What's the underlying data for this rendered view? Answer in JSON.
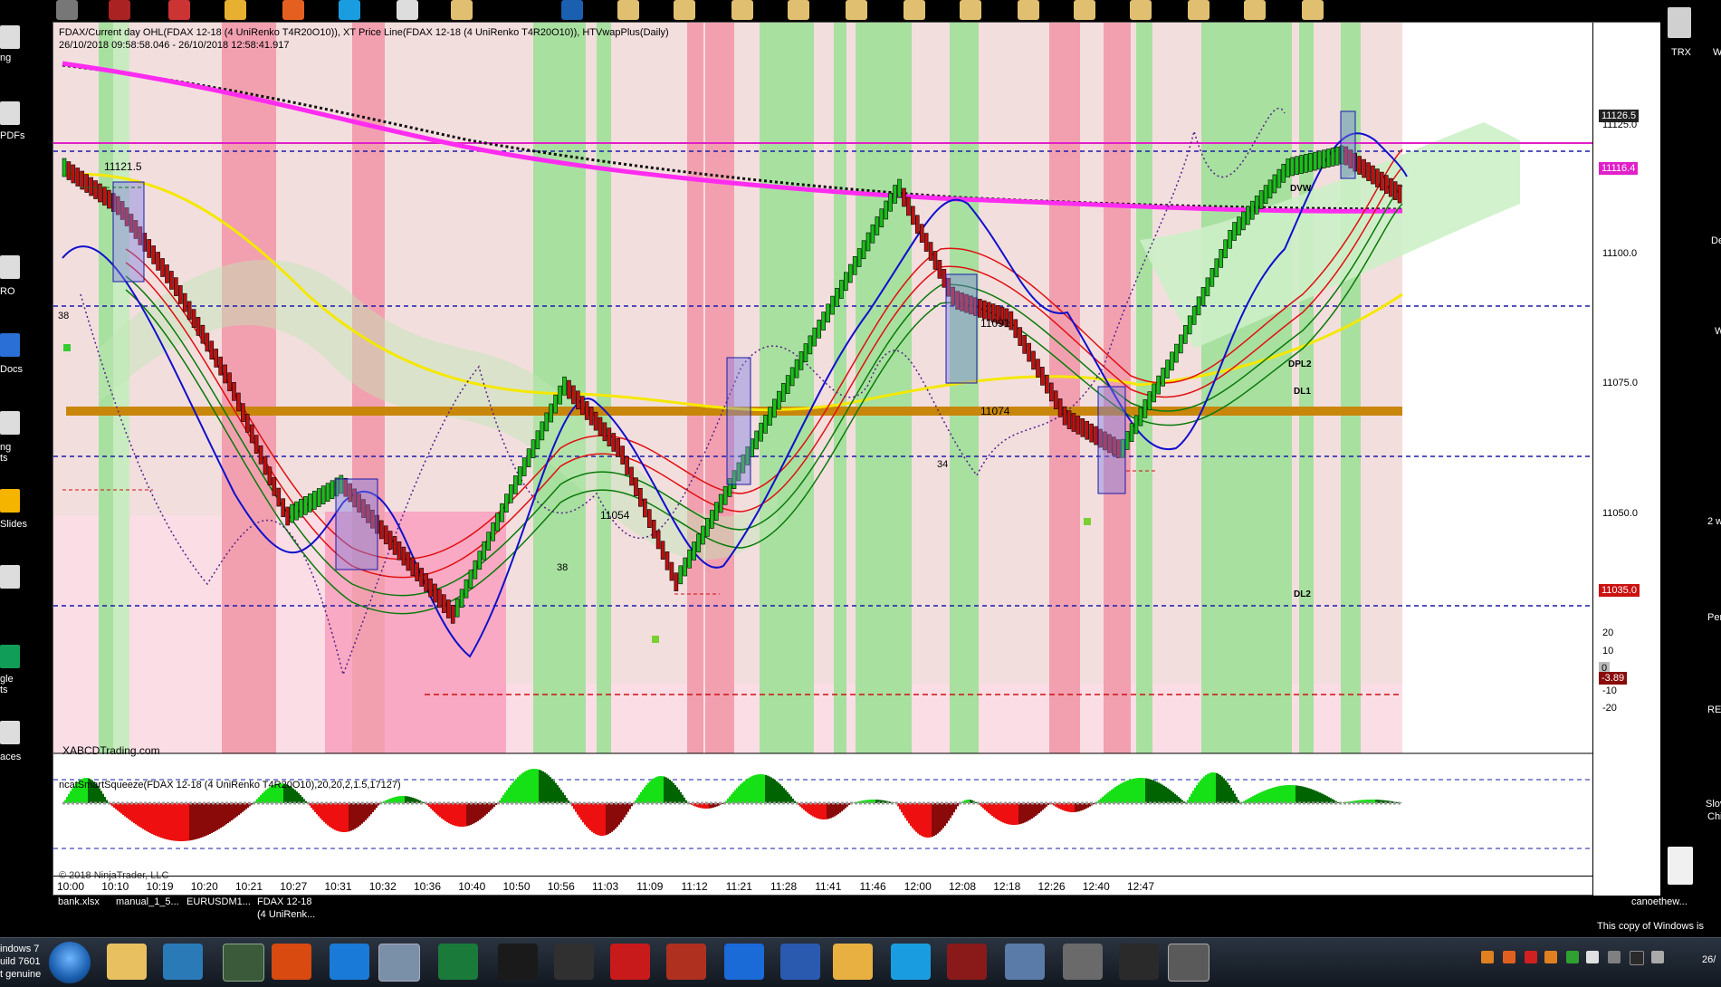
{
  "window": {
    "price_title_line1": "FDAX/Current day OHL(FDAX 12-18 (4 UniRenko T4R20O10)), XT Price Line(FDAX 12-18 (4 UniRenko T4R20O10)), HTVwapPlus(Daily)",
    "price_title_line2": "26/10/2018 09:58:58.046 - 26/10/2018 12:58:41.917",
    "site_label": "XABCDTrading.com",
    "indicator_title": "ncatSmartSqueeze(FDAX 12-18 (4 UniRenko T4R20O10),20,20,2,1.5,17127)",
    "copyright": "© 2018 NinjaTrader, LLC"
  },
  "price_axis": {
    "ticks": [
      "11125.0",
      "11100.0",
      "11075.0",
      "11050.0"
    ],
    "badges": [
      {
        "text": "11126.5",
        "color": "#222222"
      },
      {
        "text": "11116.4",
        "color": "#e020c8"
      },
      {
        "text": "11035.0",
        "color": "#cc1111"
      }
    ],
    "line_names": [
      "DVW",
      "DPL2",
      "DL1",
      "DL2"
    ]
  },
  "indicator_axis": {
    "ticks": [
      "20",
      "10",
      "0",
      "-3.89",
      "-10",
      "-20"
    ]
  },
  "annotations": {
    "hi_label": "11121.5",
    "lo_label_1": "11054",
    "mid_label": "11091",
    "lo_label_2": "11074",
    "count_1": "38",
    "count_2": "38",
    "count_3": "34"
  },
  "time_axis": [
    "10:00",
    "10:10",
    "10:19",
    "10:20",
    "10:21",
    "10:27",
    "10:31",
    "10:32",
    "10:36",
    "10:40",
    "10:50",
    "10:56",
    "11:03",
    "11:09",
    "11:12",
    "11:21",
    "11:28",
    "11:41",
    "11:46",
    "12:00",
    "12:08",
    "12:18",
    "12:26",
    "12:40",
    "12:47"
  ],
  "chart_data": {
    "type": "line",
    "title": "",
    "xlabel": "",
    "ylabel": "",
    "x": [
      "10:00",
      "10:10",
      "10:19",
      "10:20",
      "10:21",
      "10:27",
      "10:31",
      "10:32",
      "10:36",
      "10:40",
      "10:50",
      "10:56",
      "11:03",
      "11:09",
      "11:12",
      "11:21",
      "11:28",
      "11:41",
      "11:46",
      "12:00",
      "12:08",
      "12:18",
      "12:26",
      "12:40",
      "12:47"
    ],
    "ylim": [
      11030,
      11140
    ],
    "series": [
      {
        "values": [
          11118,
          11112,
          11100,
          11085,
          11065,
          11070,
          11060,
          11050,
          11068,
          11085,
          11075,
          11055,
          11070,
          11085,
          11100,
          11115,
          11098,
          11095,
          11080,
          11075,
          11090,
          11108,
          11118,
          11120,
          11114
        ]
      }
    ],
    "levels": [
      {
        "name": "DVW",
        "value": 11116.4,
        "color": "#e020c8"
      },
      {
        "name": "DPL2",
        "value": 11084,
        "color": "#c8860a"
      },
      {
        "name": "DL1",
        "value": 11075.0,
        "color": "#1a1aaa"
      },
      {
        "name": "DL2",
        "value": 11035.0,
        "color": "#cc1111"
      }
    ]
  },
  "bottom_tabs": [
    {
      "label": "bank.xlsx"
    },
    {
      "label": "manual_1_5..."
    },
    {
      "label": "EURUSDM1..."
    },
    {
      "label": "FDAX 12-18\n(4 UniRenk..."
    },
    {
      "label": "canoethew..."
    }
  ],
  "desktop_left": [
    "ng",
    "PDFs",
    "RO",
    "Docs",
    "ng",
    "ts",
    "Slides",
    "gle",
    "ts",
    "aces"
  ],
  "desktop_right": [
    "TRX",
    "W",
    "Den",
    "W",
    "2 w",
    "Pen",
    "REN",
    "Slov",
    "Chil"
  ],
  "taskbar": {
    "notice_line1": "This copy of Windows is",
    "build_line1": "indows 7",
    "build_line2": "uild 7601",
    "build_line3": "t genuine",
    "clock": "26/"
  }
}
